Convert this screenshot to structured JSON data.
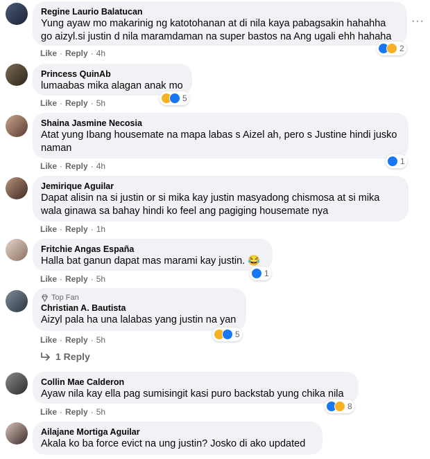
{
  "comments": [
    {
      "name": "Regine Laurio Balatucan",
      "text": "Yung ayaw mo makarinig ng katotohanan at di nila kaya pabagsakin hahahha go aizyl.si justin d nila maramdaman na super bastos na Ang ugali ehh hahaha",
      "like": "Like",
      "reply": "Reply",
      "time": "4h",
      "reactions": [
        "like",
        "haha"
      ],
      "reaction_count": "2"
    },
    {
      "name": "Princess QuinAb",
      "text": "lumaabas mika alagan anak mo",
      "like": "Like",
      "reply": "Reply",
      "time": "5h",
      "reactions": [
        "haha",
        "like"
      ],
      "reaction_count": "5"
    },
    {
      "name": "Shaina Jasmine Necosia",
      "text": "Atat yung Ibang housemate na mapa labas s Aizel ah, pero s Justine hindi jusko naman",
      "like": "Like",
      "reply": "Reply",
      "time": "4h",
      "reactions": [
        "like"
      ],
      "reaction_count": "1"
    },
    {
      "name": "Jemirique Aguilar",
      "text": "Dapat alisin na si justin or si mika kay justin masyadong chismosa at si mika wala ginawa sa bahay hindi ko feel ang pagiging housemate nya",
      "like": "Like",
      "reply": "Reply",
      "time": "1h"
    },
    {
      "name": "Fritchie Angas España",
      "text": "Halla bat ganun dapat mas marami kay justin. 😂",
      "like": "Like",
      "reply": "Reply",
      "time": "5h",
      "reactions": [
        "like"
      ],
      "reaction_count": "1"
    },
    {
      "badge": "Top Fan",
      "name": "Christian A. Bautista",
      "text": "Aizyl pala ha una lalabas yang justin na yan",
      "like": "Like",
      "reply": "Reply",
      "time": "5h",
      "reactions": [
        "haha",
        "like"
      ],
      "reaction_count": "5",
      "replies_label": "1 Reply"
    },
    {
      "name": "Collin Mae Calderon",
      "text": "Ayaw nila kay ella pag sumisingit kasi puro backstab yung chika nila",
      "like": "Like",
      "reply": "Reply",
      "time": "5h",
      "reactions": [
        "like",
        "haha"
      ],
      "reaction_count": "8"
    },
    {
      "name": "Ailajane Mortiga Aguilar",
      "text": "Akala ko ba force evict na ung justin? Josko di ako updated"
    }
  ],
  "more_options": "···",
  "colors": {
    "bubble": "#f0f2f5",
    "meta": "#65676b",
    "like": "#1877f2",
    "haha": "#f7b125"
  }
}
